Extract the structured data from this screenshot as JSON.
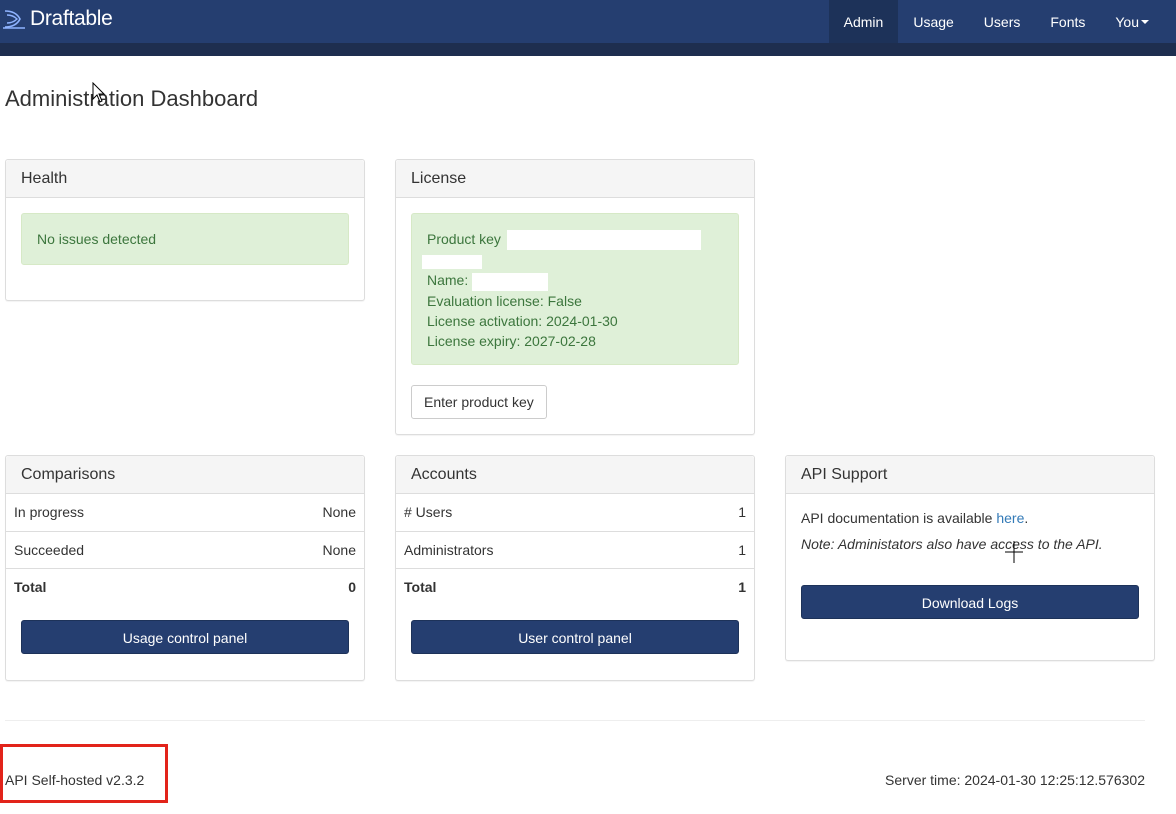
{
  "navbar": {
    "brand": "Draftable",
    "items": [
      {
        "label": "Admin",
        "active": true
      },
      {
        "label": "Usage",
        "active": false
      },
      {
        "label": "Users",
        "active": false
      },
      {
        "label": "Fonts",
        "active": false
      },
      {
        "label": "You",
        "active": false
      }
    ],
    "color": "#253e70"
  },
  "page_title": "Administration Dashboard",
  "health": {
    "title": "Health",
    "status": "No issues detected"
  },
  "license": {
    "title": "License",
    "product_key_label": "Product key",
    "name_label": "Name:",
    "evaluation": "Evaluation license: False",
    "activation": "License activation: 2024-01-30",
    "expiry": "License expiry: 2027-02-28",
    "button": "Enter product key"
  },
  "comparisons": {
    "title": "Comparisons",
    "rows": [
      {
        "label": "In progress",
        "value": "None"
      },
      {
        "label": "Succeeded",
        "value": "None"
      },
      {
        "label": "Total",
        "value": "0"
      }
    ],
    "button": "Usage control panel"
  },
  "accounts": {
    "title": "Accounts",
    "rows": [
      {
        "label": "# Users",
        "value": "1"
      },
      {
        "label": "Administrators",
        "value": "1"
      },
      {
        "label": "Total",
        "value": "1"
      }
    ],
    "button": "User control panel"
  },
  "api_support": {
    "title": "API Support",
    "doc_text": "API documentation is available ",
    "doc_link": "here",
    "doc_end": ".",
    "note": "Note: Administators also have access to the API.",
    "button": "Download Logs"
  },
  "footer": {
    "version": "API Self-hosted v2.3.2",
    "server_time": "Server time: 2024-01-30 12:25:12.576302"
  },
  "colors": {
    "primary": "#253e70",
    "success_bg": "#dff0d8",
    "success_text": "#3c763d",
    "link": "#337ab7",
    "highlight": "#e2231a"
  }
}
